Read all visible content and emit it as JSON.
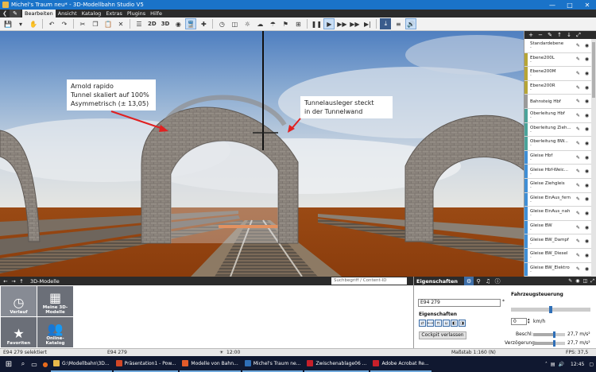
{
  "window": {
    "title": "Michel's Traum neu* - 3D-Modellbahn Studio V5",
    "controls": [
      "—",
      "□",
      "✕"
    ]
  },
  "menu": {
    "items": [
      "Bearbeiten",
      "Ansicht",
      "Katalog",
      "Extras",
      "Plugins",
      "Hilfe"
    ]
  },
  "toolbar": {
    "label_2d": "2D",
    "label_3d": "3D"
  },
  "viewport": {
    "annotation_1": [
      "Arnold rapido",
      "Tunnel skaliert auf 100%",
      "Asymmetrisch (± 13,05)"
    ],
    "annotation_2": [
      "Tunnelausleger steckt",
      "in der Tunnelwand"
    ]
  },
  "layers": [
    {
      "name": "Standardebene",
      "sub": "-",
      "color": "#ffffff"
    },
    {
      "name": "Ebene200L",
      "sub": "-",
      "color": "#b6a536"
    },
    {
      "name": "Ebene200M",
      "sub": "-",
      "color": "#b6a536"
    },
    {
      "name": "Ebene200R",
      "sub": "-",
      "color": "#b6a536"
    },
    {
      "name": "Bahnsteig Hbf",
      "sub": "",
      "color": "#9a9a9a"
    },
    {
      "name": "Oberleitung Hbf",
      "sub": "-",
      "color": "#4aa39a"
    },
    {
      "name": "Oberleitung Zieh...",
      "sub": "-",
      "color": "#4aa39a"
    },
    {
      "name": "Oberleitung BW...",
      "sub": "-",
      "color": "#4aa39a"
    },
    {
      "name": "Gleise Hbf",
      "sub": "-",
      "color": "#3f8fd6"
    },
    {
      "name": "Gleise Hbf-Weic...",
      "sub": "-",
      "color": "#3f8fd6"
    },
    {
      "name": "Gleise Ziehgleis",
      "sub": "-",
      "color": "#3f8fd6"
    },
    {
      "name": "Gleise EinAus_fern",
      "sub": "-",
      "color": "#3f8fd6"
    },
    {
      "name": "Gleise EinAus_nah",
      "sub": "-",
      "color": "#3f8fd6"
    },
    {
      "name": "Gleise BW",
      "sub": "-",
      "color": "#3f8fd6"
    },
    {
      "name": "Gleise BW_Dampf",
      "sub": "-",
      "color": "#3f8fd6"
    },
    {
      "name": "Gleise BW_Diesel",
      "sub": "-",
      "color": "#3f8fd6"
    },
    {
      "name": "Gleise BW_Elektro",
      "sub": "-",
      "color": "#3f8fd6"
    }
  ],
  "models": {
    "header": "3D-Modelle",
    "search_placeholder": "Suchbegriff / Content-ID",
    "tiles": [
      {
        "label": "Verlauf",
        "icon": "clock-icon"
      },
      {
        "label": "Meine 3D-Modelle",
        "icon": "grid-icon"
      },
      {
        "label": "Favoriten",
        "icon": "star-icon"
      },
      {
        "label": "Online-Katalog",
        "icon": "users-icon"
      }
    ]
  },
  "properties": {
    "header": "Eigenschaften",
    "vehicle_name": "E94 279",
    "eigenschaften_label": "Eigenschaften",
    "cockpit_button": "Cockpit verlassen",
    "fahrzeug_label": "Fahrzeugsteuerung",
    "speed_value": "0",
    "speed_unit": "km/h",
    "speed_level_percent": 48,
    "beschl_label": "Beschl:",
    "beschl_value": "27,7 m/s²",
    "beschl_level_percent": 62,
    "verz_label": "Verzögerung:",
    "verz_value": "27,7 m/s²",
    "verz_level_percent": 62
  },
  "status": {
    "selection": "E94 279 selektiert",
    "object": "E94 279",
    "time": "12:00",
    "scale": "Maßstab 1:160 (N)",
    "fps": "FPS: 37,5"
  },
  "taskbar": {
    "apps": [
      {
        "label": "G:\\Modellbahn\\3D...",
        "color": "#e8b84a"
      },
      {
        "label": "Präsentation1 - Pow...",
        "color": "#d24726"
      },
      {
        "label": "Modelle von Bahn...",
        "color": "#e25b2a"
      },
      {
        "label": "Michel's Traum ne...",
        "color": "#2f6fb7"
      },
      {
        "label": "Zwischenablage06 ...",
        "color": "#c7202a"
      },
      {
        "label": "Adobe Acrobat Re...",
        "color": "#c7202a"
      }
    ],
    "clock": "12:45"
  }
}
